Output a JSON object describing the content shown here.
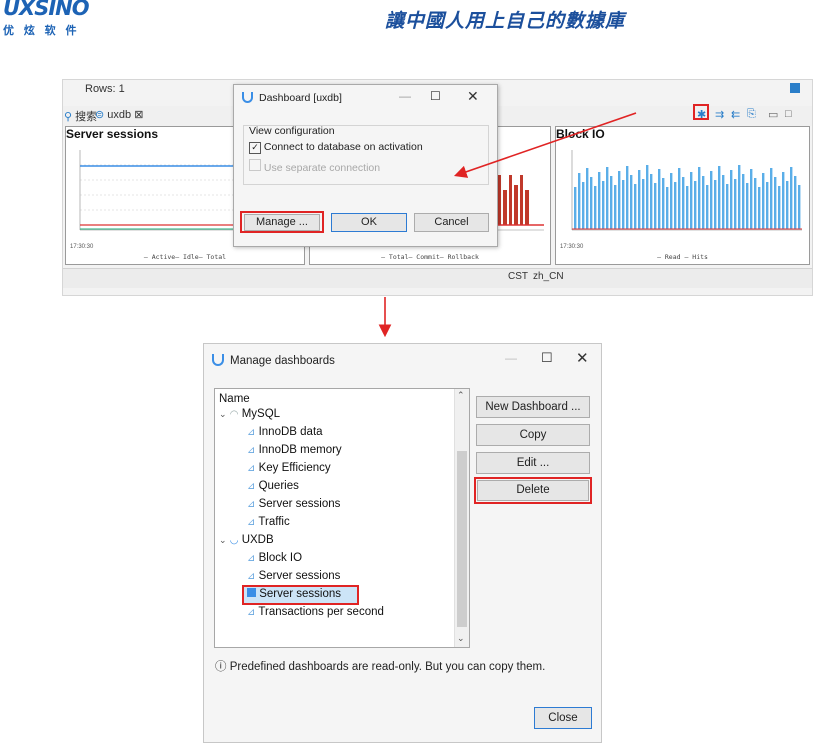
{
  "logo": {
    "word": "UXSINO",
    "sub": "优 炫 软 件"
  },
  "slogan": "讓中國人用上自己的數據庫",
  "top_window": {
    "rows_label": "Rows: 1",
    "tab_search": "搜索",
    "tab_uxdb": "uxdb ⊠",
    "statusbar": {
      "timezone": "CST",
      "locale": "zh_CN"
    },
    "charts": [
      {
        "title": "Server sessions",
        "legend": "— Active— Idle— Total",
        "time": "17:30:30"
      },
      {
        "title": "",
        "legend": "— Total— Commit— Rollback",
        "time": ""
      },
      {
        "title": "Block IO",
        "legend": "— Read — Hits",
        "time": "17:30:30"
      }
    ]
  },
  "dashboard_dialog": {
    "title": "Dashboard [uxdb]",
    "group_label": "View configuration",
    "check_connect": "Connect to database on activation",
    "check_separate": "Use separate connection",
    "btn_manage": "Manage ...",
    "btn_ok": "OK",
    "btn_cancel": "Cancel"
  },
  "manage_dialog": {
    "title": "Manage dashboards",
    "tree_header": "Name",
    "groups": [
      {
        "name": "MySQL",
        "items": [
          "InnoDB data",
          "InnoDB memory",
          "Key Efficiency",
          "Queries",
          "Server sessions",
          "Traffic"
        ]
      },
      {
        "name": "UXDB",
        "items": [
          "Block IO",
          "Server sessions",
          "Server sessions",
          "Transactions per second"
        ]
      }
    ],
    "btn_new": "New Dashboard ...",
    "btn_copy": "Copy",
    "btn_edit": "Edit ...",
    "btn_delete": "Delete",
    "btn_close": "Close",
    "info": "Predefined dashboards are read-only. But you can copy them."
  },
  "colors": {
    "brand": "#1d63b5",
    "highlight": "#e02424",
    "selection": "#cce4f7",
    "accent": "#2d7bd3"
  }
}
